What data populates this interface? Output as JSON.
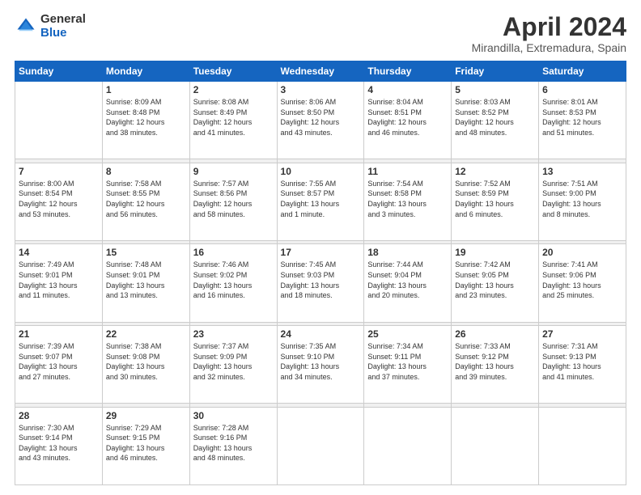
{
  "logo": {
    "general": "General",
    "blue": "Blue"
  },
  "title": {
    "month": "April 2024",
    "location": "Mirandilla, Extremadura, Spain"
  },
  "weekdays": [
    "Sunday",
    "Monday",
    "Tuesday",
    "Wednesday",
    "Thursday",
    "Friday",
    "Saturday"
  ],
  "weeks": [
    [
      {
        "day": "",
        "info": ""
      },
      {
        "day": "1",
        "info": "Sunrise: 8:09 AM\nSunset: 8:48 PM\nDaylight: 12 hours\nand 38 minutes."
      },
      {
        "day": "2",
        "info": "Sunrise: 8:08 AM\nSunset: 8:49 PM\nDaylight: 12 hours\nand 41 minutes."
      },
      {
        "day": "3",
        "info": "Sunrise: 8:06 AM\nSunset: 8:50 PM\nDaylight: 12 hours\nand 43 minutes."
      },
      {
        "day": "4",
        "info": "Sunrise: 8:04 AM\nSunset: 8:51 PM\nDaylight: 12 hours\nand 46 minutes."
      },
      {
        "day": "5",
        "info": "Sunrise: 8:03 AM\nSunset: 8:52 PM\nDaylight: 12 hours\nand 48 minutes."
      },
      {
        "day": "6",
        "info": "Sunrise: 8:01 AM\nSunset: 8:53 PM\nDaylight: 12 hours\nand 51 minutes."
      }
    ],
    [
      {
        "day": "7",
        "info": "Sunrise: 8:00 AM\nSunset: 8:54 PM\nDaylight: 12 hours\nand 53 minutes."
      },
      {
        "day": "8",
        "info": "Sunrise: 7:58 AM\nSunset: 8:55 PM\nDaylight: 12 hours\nand 56 minutes."
      },
      {
        "day": "9",
        "info": "Sunrise: 7:57 AM\nSunset: 8:56 PM\nDaylight: 12 hours\nand 58 minutes."
      },
      {
        "day": "10",
        "info": "Sunrise: 7:55 AM\nSunset: 8:57 PM\nDaylight: 13 hours\nand 1 minute."
      },
      {
        "day": "11",
        "info": "Sunrise: 7:54 AM\nSunset: 8:58 PM\nDaylight: 13 hours\nand 3 minutes."
      },
      {
        "day": "12",
        "info": "Sunrise: 7:52 AM\nSunset: 8:59 PM\nDaylight: 13 hours\nand 6 minutes."
      },
      {
        "day": "13",
        "info": "Sunrise: 7:51 AM\nSunset: 9:00 PM\nDaylight: 13 hours\nand 8 minutes."
      }
    ],
    [
      {
        "day": "14",
        "info": "Sunrise: 7:49 AM\nSunset: 9:01 PM\nDaylight: 13 hours\nand 11 minutes."
      },
      {
        "day": "15",
        "info": "Sunrise: 7:48 AM\nSunset: 9:01 PM\nDaylight: 13 hours\nand 13 minutes."
      },
      {
        "day": "16",
        "info": "Sunrise: 7:46 AM\nSunset: 9:02 PM\nDaylight: 13 hours\nand 16 minutes."
      },
      {
        "day": "17",
        "info": "Sunrise: 7:45 AM\nSunset: 9:03 PM\nDaylight: 13 hours\nand 18 minutes."
      },
      {
        "day": "18",
        "info": "Sunrise: 7:44 AM\nSunset: 9:04 PM\nDaylight: 13 hours\nand 20 minutes."
      },
      {
        "day": "19",
        "info": "Sunrise: 7:42 AM\nSunset: 9:05 PM\nDaylight: 13 hours\nand 23 minutes."
      },
      {
        "day": "20",
        "info": "Sunrise: 7:41 AM\nSunset: 9:06 PM\nDaylight: 13 hours\nand 25 minutes."
      }
    ],
    [
      {
        "day": "21",
        "info": "Sunrise: 7:39 AM\nSunset: 9:07 PM\nDaylight: 13 hours\nand 27 minutes."
      },
      {
        "day": "22",
        "info": "Sunrise: 7:38 AM\nSunset: 9:08 PM\nDaylight: 13 hours\nand 30 minutes."
      },
      {
        "day": "23",
        "info": "Sunrise: 7:37 AM\nSunset: 9:09 PM\nDaylight: 13 hours\nand 32 minutes."
      },
      {
        "day": "24",
        "info": "Sunrise: 7:35 AM\nSunset: 9:10 PM\nDaylight: 13 hours\nand 34 minutes."
      },
      {
        "day": "25",
        "info": "Sunrise: 7:34 AM\nSunset: 9:11 PM\nDaylight: 13 hours\nand 37 minutes."
      },
      {
        "day": "26",
        "info": "Sunrise: 7:33 AM\nSunset: 9:12 PM\nDaylight: 13 hours\nand 39 minutes."
      },
      {
        "day": "27",
        "info": "Sunrise: 7:31 AM\nSunset: 9:13 PM\nDaylight: 13 hours\nand 41 minutes."
      }
    ],
    [
      {
        "day": "28",
        "info": "Sunrise: 7:30 AM\nSunset: 9:14 PM\nDaylight: 13 hours\nand 43 minutes."
      },
      {
        "day": "29",
        "info": "Sunrise: 7:29 AM\nSunset: 9:15 PM\nDaylight: 13 hours\nand 46 minutes."
      },
      {
        "day": "30",
        "info": "Sunrise: 7:28 AM\nSunset: 9:16 PM\nDaylight: 13 hours\nand 48 minutes."
      },
      {
        "day": "",
        "info": ""
      },
      {
        "day": "",
        "info": ""
      },
      {
        "day": "",
        "info": ""
      },
      {
        "day": "",
        "info": ""
      }
    ]
  ]
}
